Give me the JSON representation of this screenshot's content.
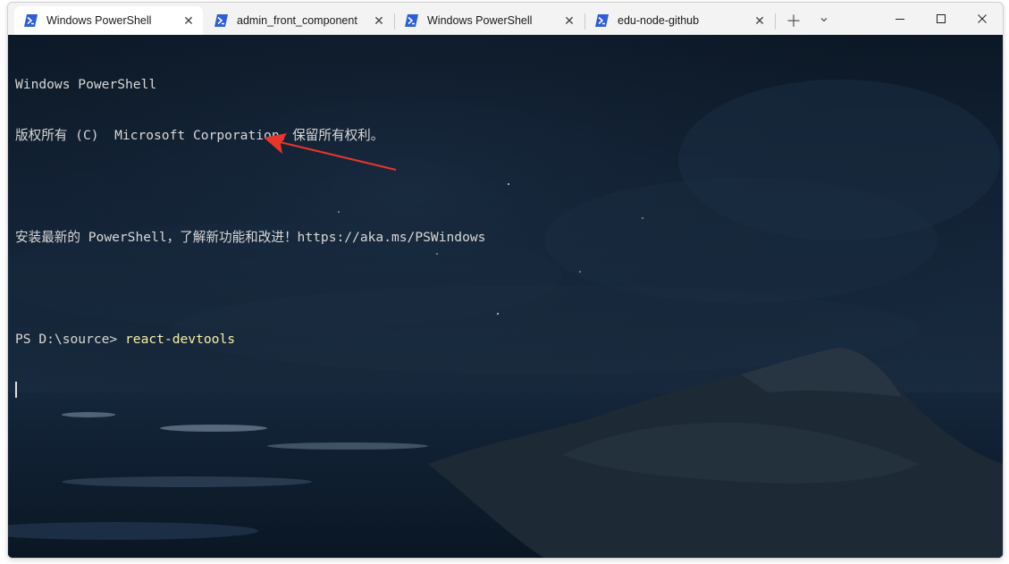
{
  "tabs": [
    {
      "label": "Windows PowerShell",
      "icon": "powershell-icon",
      "active": true
    },
    {
      "label": "admin_front_component",
      "icon": "powershell-icon",
      "active": false
    },
    {
      "label": "Windows PowerShell",
      "icon": "powershell-icon",
      "active": false
    },
    {
      "label": "edu-node-github",
      "icon": "powershell-icon",
      "active": false
    }
  ],
  "tab_close_glyph": "✕",
  "new_tab_glyph": "＋",
  "dropdown_glyph": "⌄",
  "terminal": {
    "banner_line1": "Windows PowerShell",
    "banner_line2": "版权所有 (C)  Microsoft Corporation。保留所有权利。",
    "banner_line3": "安装最新的 PowerShell，了解新功能和改进！https://aka.ms/PSWindows",
    "prompt": "PS D:\\source> ",
    "command": "react-devtools"
  },
  "colors": {
    "annotation_arrow": "#e8362b",
    "command_text": "#f9f1a5",
    "terminal_text": "#d8d8d8",
    "powershell_icon": "#2b5ed8"
  }
}
